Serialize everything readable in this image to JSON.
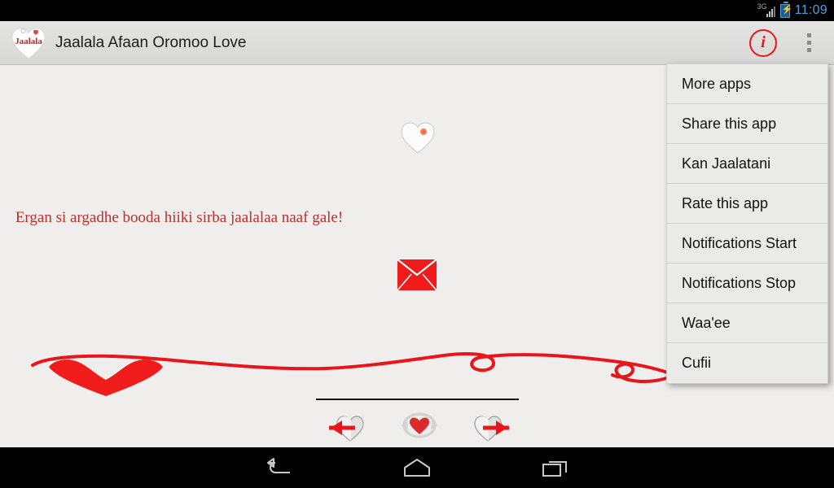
{
  "status_bar": {
    "network_label": "3G",
    "signal_icon": "signal-bars-icon",
    "battery_icon": "battery-charging-icon",
    "clock": "11:09"
  },
  "action_bar": {
    "logo_icon": "app-logo-heart-icon",
    "logo_text": "Jaalala",
    "title": "Jaalala Afaan Oromoo Love",
    "info_icon": "info-icon",
    "info_label": "i",
    "overflow_icon": "overflow-menu-icon"
  },
  "content": {
    "top_heart_icon": "heart-outline-icon",
    "message": "Ergan si argadhe booda hiiki sirba jaalalaa naaf gale!",
    "envelope_icon": "envelope-icon",
    "ribbon_icon": "heart-ribbon-decoration",
    "controls": {
      "previous_icon": "previous-heart-arrow-icon",
      "random_icon": "random-heart-refresh-icon",
      "next_icon": "next-heart-arrow-icon"
    }
  },
  "overflow_menu": {
    "items": [
      {
        "label": "More apps"
      },
      {
        "label": "Share this app"
      },
      {
        "label": "Kan Jaalatani"
      },
      {
        "label": "Rate this app"
      },
      {
        "label": "Notifications Start"
      },
      {
        "label": "Notifications Stop"
      },
      {
        "label": "Waa'ee"
      },
      {
        "label": "Cufii"
      }
    ]
  },
  "system_nav": {
    "back_icon": "back-arrow-icon",
    "home_icon": "home-icon",
    "recents_icon": "recent-apps-icon"
  },
  "colors": {
    "accent_red": "#e8151a",
    "text_red": "#b8312f",
    "status_blue": "#4aa3de",
    "background": "#efeeec",
    "bar_background": "#dedede"
  }
}
